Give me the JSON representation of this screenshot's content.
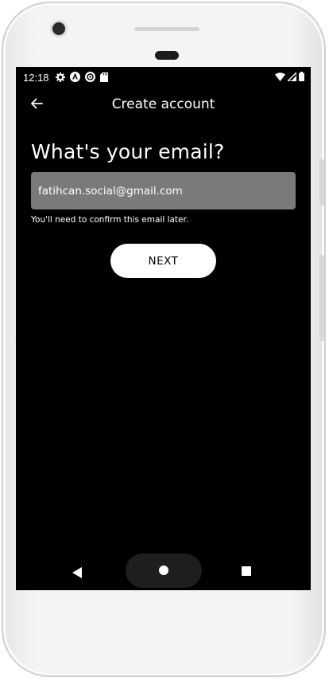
{
  "status_bar": {
    "time": "12:18",
    "left_icons": [
      "gear-icon",
      "a-circle-icon",
      "at-circle-icon",
      "sd-card-icon"
    ],
    "right_icons": [
      "wifi-icon",
      "signal-icon",
      "battery-icon"
    ]
  },
  "app_bar": {
    "back_icon": "arrow-left-icon",
    "title": "Create account"
  },
  "form": {
    "heading": "What's your email?",
    "email_value": "fatihcan.social@gmail.com",
    "helper_text": "You'll need to confirm this email later.",
    "next_label": "NEXT"
  },
  "nav_bar": {
    "icons": [
      "triangle-back-icon",
      "home-circle-icon",
      "square-recents-icon"
    ]
  },
  "colors": {
    "screen_background": "#000000",
    "input_background": "#7a7a7a",
    "button_background": "#ffffff",
    "text": "#ffffff"
  }
}
